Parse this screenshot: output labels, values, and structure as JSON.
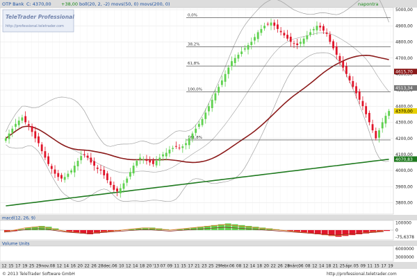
{
  "header": {
    "instrument": "OTP Bank",
    "price_label": "C: 4370,00",
    "change": "+38,00",
    "indicators": "boll(20, 2, -2) movs(50, 0) movs(200, 0)",
    "corner_link": "napontra"
  },
  "watermark": {
    "logo": "TeleTrader Professional",
    "url": "http://professional.teletrader.com"
  },
  "macd_panel": {
    "label": "macd(12, 26, 9)"
  },
  "volume_panel": {
    "label": "Volume Units"
  },
  "footer": {
    "copyright": "© 2013 TeleTrader Software GmbH",
    "url": "http://professional.teletrader.com"
  },
  "colors": {
    "background": "#ffffff",
    "header_bar": "#dddddd",
    "grid": "#e3e3e3",
    "candle_up": "#5fd14f",
    "candle_down": "#e0152a",
    "bollinger": "#a0a0a0",
    "ma50": "#8b1a1a",
    "ma200": "#1f7a1f",
    "fib_line": "#333333",
    "macd_pos": "#5fd14f",
    "macd_neg": "#e0152a"
  },
  "chart_data": [
    {
      "type": "candlestick",
      "title": "OTP Bank",
      "ylim": [
        3750,
        5000
      ],
      "y_ticks": [
        "3800,00",
        "3900,00",
        "4000,00",
        "4100,00",
        "4200,00",
        "4300,00",
        "4400,00",
        "4500,00",
        "4600,00",
        "4700,00",
        "4800,00",
        "4900,00",
        "5000,00"
      ],
      "x_ticks": [
        "12",
        "15",
        "17",
        "19",
        "25",
        "29",
        "nov.",
        "08",
        "12",
        "14",
        "16",
        "20",
        "22",
        "26",
        "28",
        "dec.",
        "06",
        "10",
        "12",
        "14",
        "18",
        "20",
        "'13",
        "07",
        "09",
        "11",
        "15",
        "17",
        "21",
        "23",
        "25",
        "29",
        "febr.",
        "06",
        "08",
        "12",
        "14",
        "18",
        "20",
        "22",
        "26",
        "28",
        "márc.",
        "06",
        "08",
        "12",
        "14",
        "18",
        "21",
        "25",
        "ápr.",
        "05",
        "09",
        "11",
        "15",
        "17",
        "19"
      ],
      "closes": [
        4200,
        4230,
        4260,
        4290,
        4310,
        4330,
        4300,
        4280,
        4240,
        4200,
        4170,
        4120,
        4080,
        4040,
        4010,
        3980,
        3960,
        3950,
        3960,
        3980,
        4000,
        4030,
        4060,
        4090,
        4100,
        4080,
        4050,
        4030,
        4010,
        4000,
        3970,
        3940,
        3910,
        3880,
        3870,
        3890,
        3920,
        3950,
        3990,
        4030,
        4060,
        4080,
        4070,
        4060,
        4050,
        4040,
        4060,
        4080,
        4100,
        4110,
        4130,
        4140,
        4150,
        4140,
        4150,
        4170,
        4200,
        4230,
        4260,
        4290,
        4320,
        4360,
        4400,
        4440,
        4480,
        4520,
        4560,
        4600,
        4640,
        4680,
        4700,
        4720,
        4740,
        4760,
        4780,
        4800,
        4830,
        4860,
        4880,
        4900,
        4910,
        4920,
        4900,
        4880,
        4860,
        4840,
        4820,
        4800,
        4790,
        4780,
        4800,
        4820,
        4840,
        4860,
        4880,
        4900,
        4890,
        4870,
        4850,
        4800,
        4760,
        4720,
        4680,
        4640,
        4600,
        4560,
        4520,
        4480,
        4440,
        4400,
        4350,
        4300,
        4250,
        4200,
        4250,
        4300,
        4340,
        4370
      ],
      "bollinger": {
        "name": "boll(20, 2, -2)"
      },
      "moving_averages": [
        {
          "name": "movs(50, 0)",
          "last": "4615,70"
        },
        {
          "name": "movs(200, 0)",
          "last": "4070,83"
        }
      ],
      "price_tags": [
        "4615,70",
        "4513,34",
        "4370,00",
        "4070,83"
      ],
      "fibonacci": [
        {
          "label": "0,0%",
          "value": 4950
        },
        {
          "label": "38,2%",
          "value": 4770
        },
        {
          "label": "61,8%",
          "value": 4650
        },
        {
          "label": "100,0%",
          "value": 4490
        },
        {
          "label": "161,8%",
          "value": 4190
        }
      ]
    },
    {
      "type": "bar",
      "title": "macd(12, 26, 9)",
      "ylim": [
        -100000,
        100000
      ],
      "y_ticks": [
        "100000",
        "0",
        "-75,6378"
      ],
      "histogram": [
        -0.2,
        -0.1,
        0.1,
        0.3,
        0.4,
        0.5,
        0.4,
        0.2,
        0.0,
        -0.2,
        -0.3,
        -0.4,
        -0.5,
        -0.4,
        -0.3,
        -0.2,
        -0.1,
        0.0,
        0.1,
        0.2,
        0.3,
        0.3,
        0.2,
        0.1,
        0.0,
        0.1,
        0.2,
        0.3,
        0.4,
        0.5,
        0.6,
        0.7,
        0.8,
        0.7,
        0.6,
        0.5,
        0.4,
        0.3,
        0.2,
        0.1,
        0.0,
        -0.1,
        -0.2,
        -0.3,
        -0.4,
        -0.5,
        -0.6,
        -0.7,
        -0.8,
        -0.7,
        -0.6,
        -0.5,
        -0.4,
        -0.3,
        -0.2,
        -0.1
      ]
    },
    {
      "type": "bar",
      "title": "Volume Units",
      "y_ticks": [
        "6000000",
        "3000000"
      ]
    }
  ]
}
